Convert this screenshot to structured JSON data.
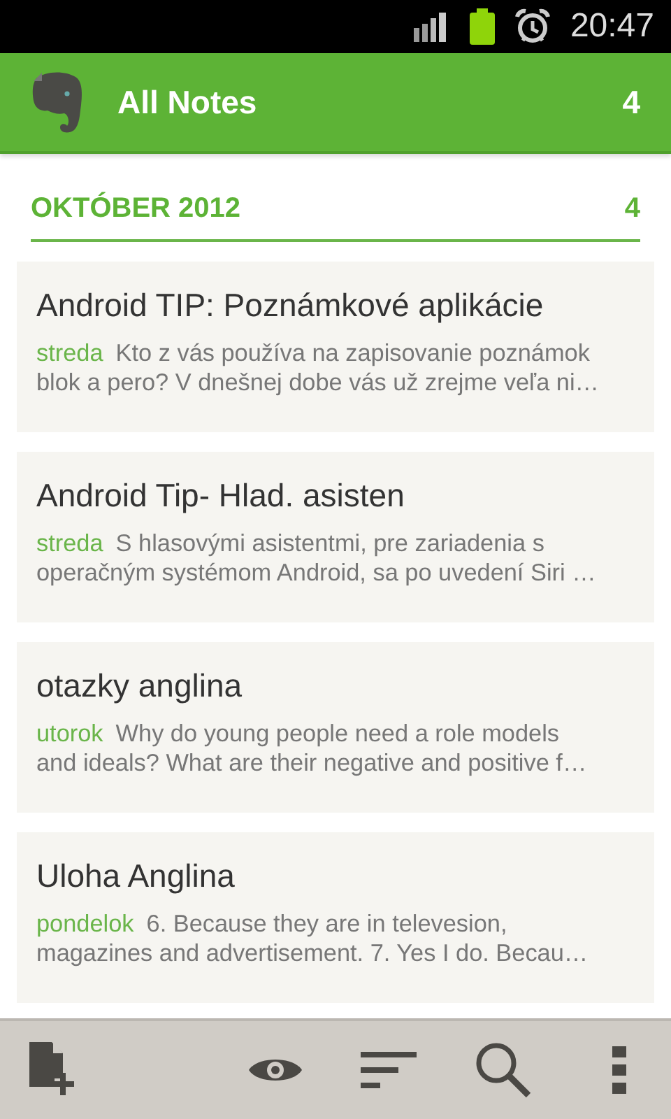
{
  "status_bar": {
    "time": "20:47"
  },
  "app_bar": {
    "title": "All Notes",
    "count": "4"
  },
  "section": {
    "title": "OKTÓBER 2012",
    "count": "4"
  },
  "notes": [
    {
      "title": "Android TIP: Poznámkové aplikácie",
      "date": "streda",
      "snippet_lines": [
        "Kto z vás používa na zapisovanie poznámok",
        "blok a pero? V dnešnej dobe vás už zrejme veľa ni…"
      ]
    },
    {
      "title": "Android Tip- Hlad. asisten",
      "date": "streda",
      "snippet_lines": [
        "S hlasovými asistentmi, pre zariadenia s",
        "operačným systémom Android, sa po uvedení Siri …"
      ]
    },
    {
      "title": "otazky anglina",
      "date": "utorok",
      "snippet_lines": [
        "Why do young people need a role models",
        "and ideals? What are their negative and positive f…"
      ]
    },
    {
      "title": "Uloha Anglina",
      "date": "pondelok",
      "snippet_lines": [
        "6. Because they are in televesion,",
        "magazines and advertisement. 7. Yes I do. Becau…"
      ]
    }
  ],
  "toolbar": [
    {
      "kind": "new-note"
    },
    {
      "kind": "view"
    },
    {
      "kind": "sort"
    },
    {
      "kind": "search"
    },
    {
      "kind": "menu"
    }
  ]
}
